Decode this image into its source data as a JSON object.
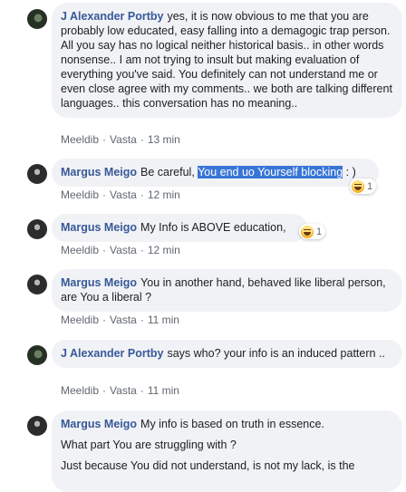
{
  "comments": [
    {
      "author": "J Alexander Portby",
      "text": "yes, it is now obvious to me that you are probably low educated, easy falling into a demagogic trap person. All you say has no logical neither historical basis.. in other words nonsense.. I am not trying to insult but making evaluation of everything you've said. You definitely can not understand me or even close agree with my comments.. we both are talking different languages.. this conversation has no meaning..",
      "like": "Meeldib",
      "reply": "Vasta",
      "time": "13 min"
    },
    {
      "author": "Margus Meigo",
      "text_before": "Be careful,",
      "text_highlight": "You end uo Yourself blocking",
      "text_after": ": )",
      "like": "Meeldib",
      "reply": "Vasta",
      "time": "12 min",
      "reaction_count": "1"
    },
    {
      "author": "Margus Meigo",
      "text": "My Info is ABOVE education,",
      "like": "Meeldib",
      "reply": "Vasta",
      "time": "12 min",
      "reaction_count": "1"
    },
    {
      "author": "Margus Meigo",
      "text": "You in another hand, behaved like liberal person, are You a liberal ?",
      "like": "Meeldib",
      "reply": "Vasta",
      "time": "11 min"
    },
    {
      "author": "J Alexander Portby",
      "text": "says who? your info is an induced pattern ..",
      "like": "Meeldib",
      "reply": "Vasta",
      "time": "11 min"
    },
    {
      "author": "Margus Meigo",
      "text": "My info is based on truth in essence.",
      "text_2": "What part You are struggling with ?",
      "text_3": "Just because You did not understand, is not my lack, is the"
    }
  ],
  "colors": {
    "author": "#385898",
    "bubble": "#f0f2f5",
    "meta": "#606770",
    "selection": "#3875d7"
  },
  "icons": {
    "reaction": "haha-emoji-icon"
  }
}
